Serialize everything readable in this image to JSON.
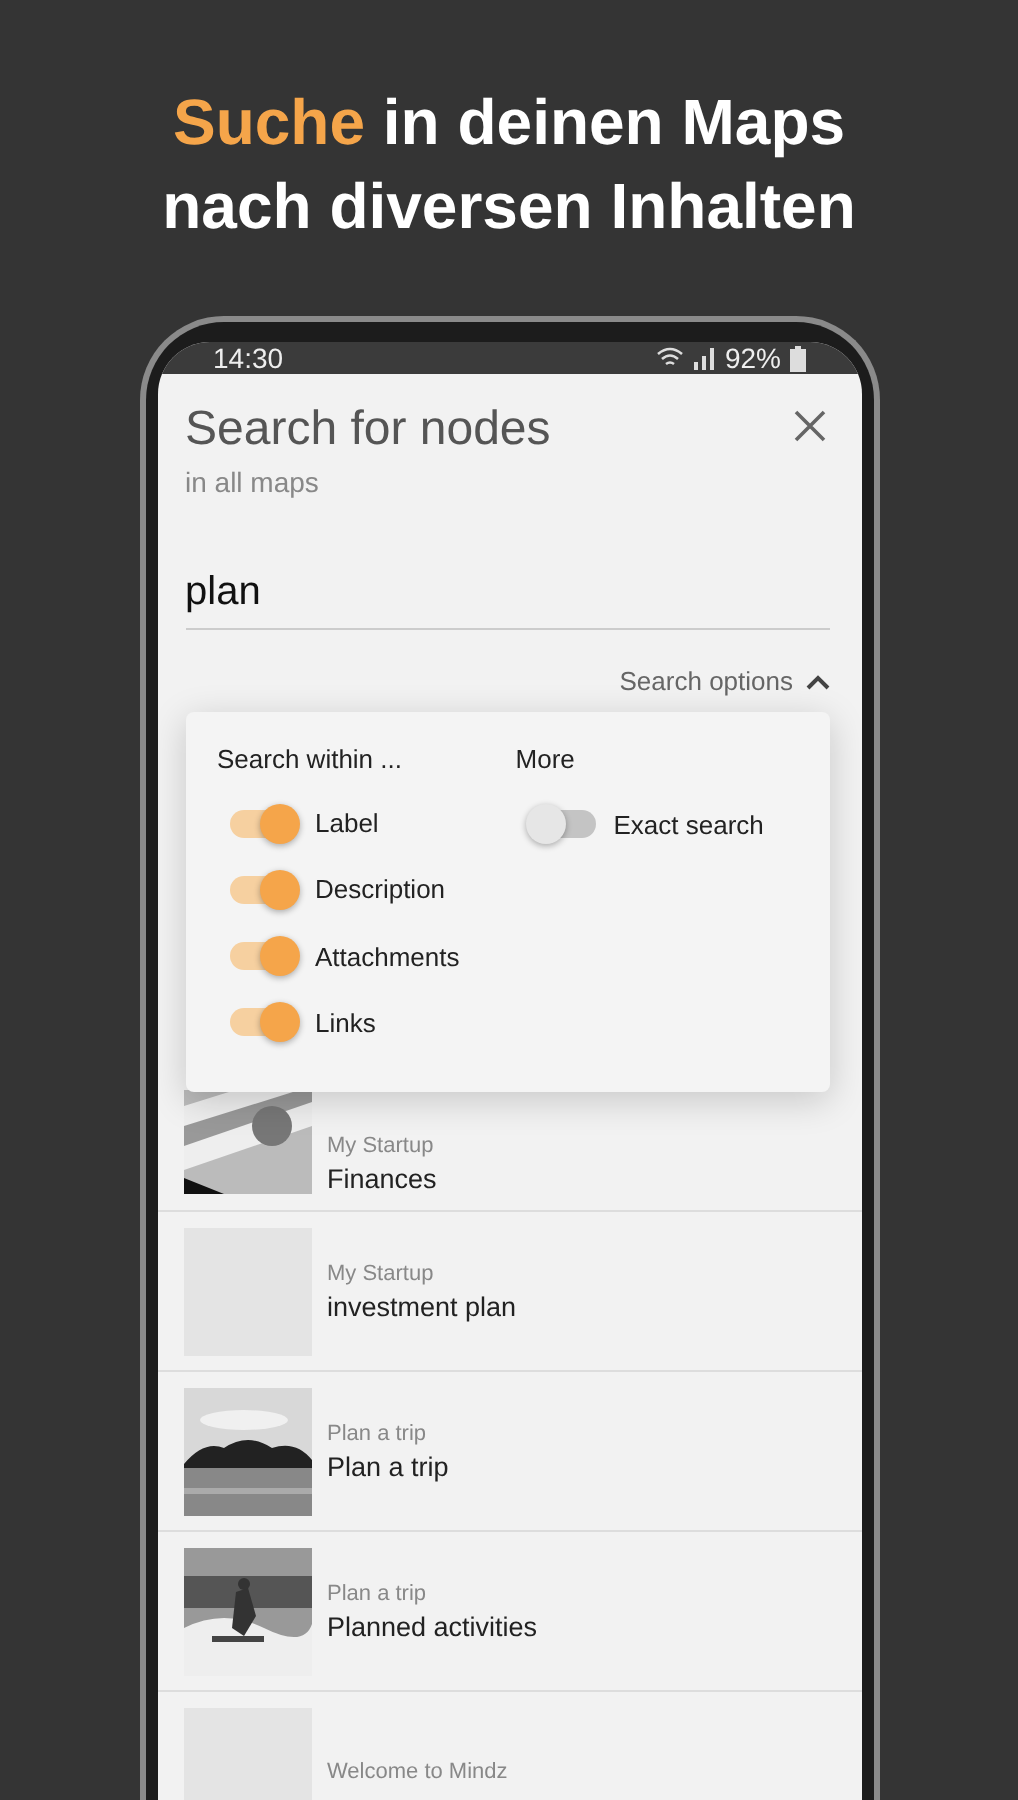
{
  "headline": [
    {
      "text": "Suche",
      "accent": true
    },
    {
      "text": " in deinen Maps nach diversen Inhalten",
      "accent": false
    }
  ],
  "status_bar": {
    "time": "14:30",
    "battery": "92%"
  },
  "dialog": {
    "title": "Search for nodes",
    "subtitle": "in all maps",
    "query": "plan",
    "options_toggle": {
      "label": "Search options",
      "expanded": true
    }
  },
  "options": {
    "within": {
      "heading": "Search within ...",
      "items": [
        {
          "label": "Label",
          "on": true
        },
        {
          "label": "Description",
          "on": true
        },
        {
          "label": "Attachments",
          "on": true
        },
        {
          "label": "Links",
          "on": true
        }
      ]
    },
    "more": {
      "heading": "More",
      "items": [
        {
          "label": "Exact search",
          "on": false
        }
      ]
    }
  },
  "results": [
    {
      "map": "My Startup",
      "title": "Finances",
      "kind": "picture"
    },
    {
      "map": "My Startup",
      "title": "investment plan",
      "kind": "blank"
    },
    {
      "map": "Plan a trip",
      "title": "Plan a trip",
      "kind": "picture"
    },
    {
      "map": "Plan a trip",
      "title": "Planned activities",
      "kind": "picture"
    },
    {
      "map": "Welcome to Mindz",
      "kind": "blank"
    }
  ]
}
